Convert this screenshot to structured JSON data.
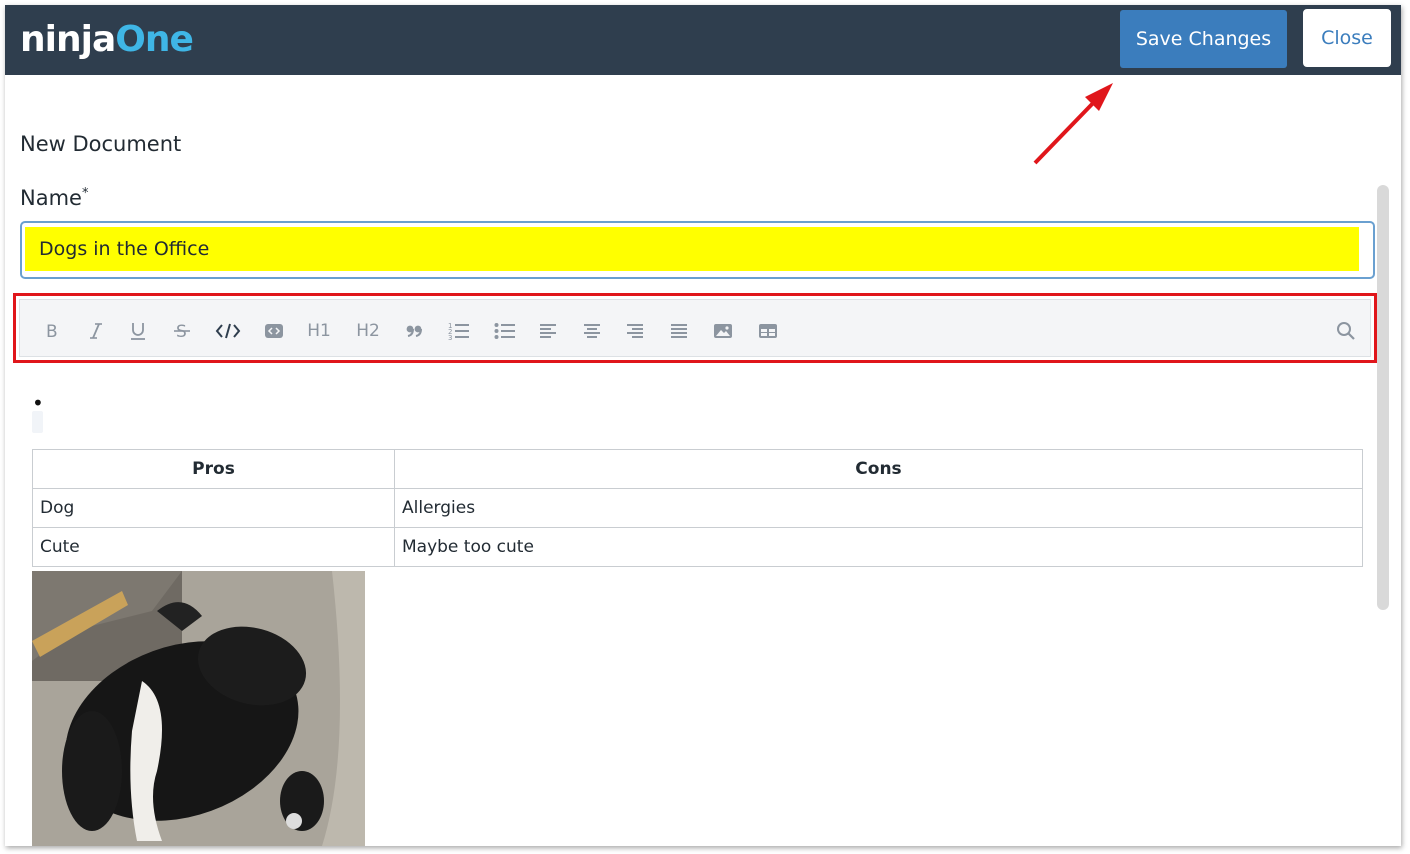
{
  "header": {
    "logo_part1": "ninja",
    "logo_part2": "One",
    "save_label": "Save Changes",
    "close_label": "Close"
  },
  "page": {
    "title": "New Document"
  },
  "form": {
    "name_label": "Name",
    "required_mark": "*",
    "name_value": "Dogs in the Office"
  },
  "toolbar": {
    "h1_label": "H1",
    "h2_label": "H2",
    "icons": [
      "bold-icon",
      "italic-icon",
      "underline-icon",
      "strikethrough-icon",
      "code-icon",
      "code-block-icon",
      "heading-1",
      "heading-2",
      "quote-icon",
      "ordered-list-icon",
      "bullet-list-icon",
      "align-left-icon",
      "align-center-icon",
      "align-right-icon",
      "align-justify-icon",
      "image-icon",
      "table-icon",
      "search-icon"
    ]
  },
  "editor": {
    "bullet": "•",
    "table": {
      "headers": [
        "Pros",
        "Cons"
      ],
      "rows": [
        [
          "Dog",
          "Allergies"
        ],
        [
          "Cute",
          "Maybe too cute"
        ]
      ]
    }
  },
  "colors": {
    "header_bg": "#2f3e4e",
    "accent": "#3b7dbd",
    "logo_one": "#3fb6e6",
    "highlight": "#ffff00",
    "annotation_red": "#e0161b"
  }
}
